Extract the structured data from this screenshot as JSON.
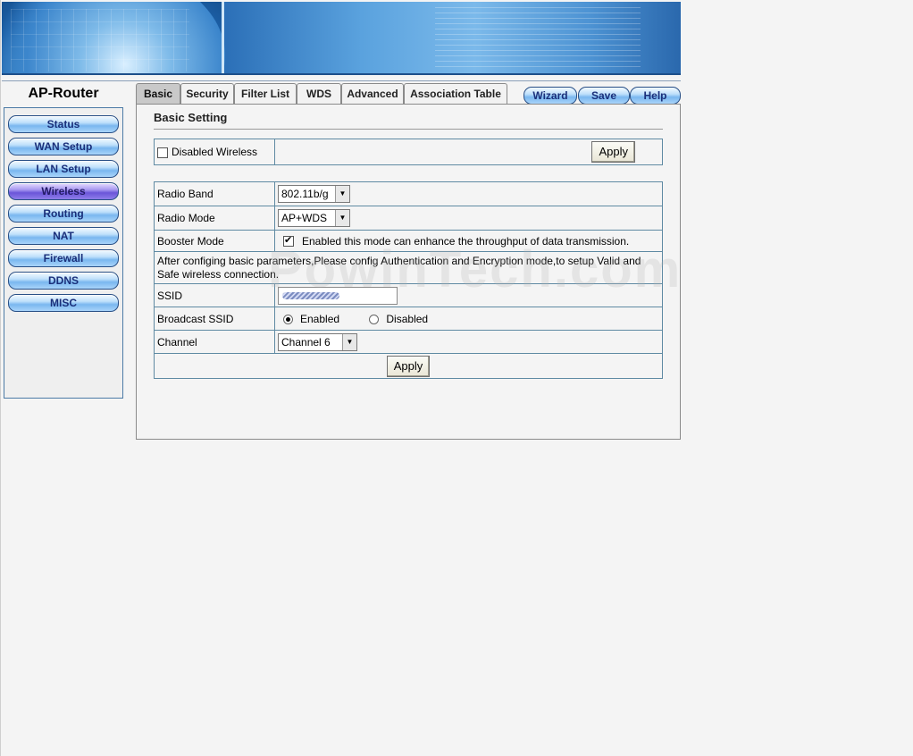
{
  "brand": "AP-Router",
  "sidebar": {
    "items": [
      {
        "label": "Status"
      },
      {
        "label": "WAN Setup"
      },
      {
        "label": "LAN Setup"
      },
      {
        "label": "Wireless"
      },
      {
        "label": "Routing"
      },
      {
        "label": "NAT"
      },
      {
        "label": "Firewall"
      },
      {
        "label": "DDNS"
      },
      {
        "label": "MISC"
      }
    ]
  },
  "tabs": [
    "Basic",
    "Security",
    "Filter List",
    "WDS",
    "Advanced",
    "Association Table"
  ],
  "actions": [
    "Wizard",
    "Save",
    "Help"
  ],
  "section": {
    "title": "Basic Setting"
  },
  "disable": {
    "label": "Disabled Wireless",
    "apply": "Apply"
  },
  "form": {
    "radio_band_label": "Radio Band",
    "radio_band_value": "802.11b/g",
    "radio_mode_label": "Radio Mode",
    "radio_mode_value": "AP+WDS",
    "booster_label": "Booster Mode",
    "booster_text": "Enabled this mode can enhance the throughput of data transmission.",
    "note": "After configing basic parameters,Please config Authentication and Encryption mode,to setup Valid and Safe wireless connection.",
    "ssid_label": "SSID",
    "broadcast_label": "Broadcast SSID",
    "enabled": "Enabled",
    "disabled": "Disabled",
    "channel_label": "Channel",
    "channel_value": "Channel 6",
    "apply": "Apply"
  },
  "watermark": "PowinTech.com"
}
